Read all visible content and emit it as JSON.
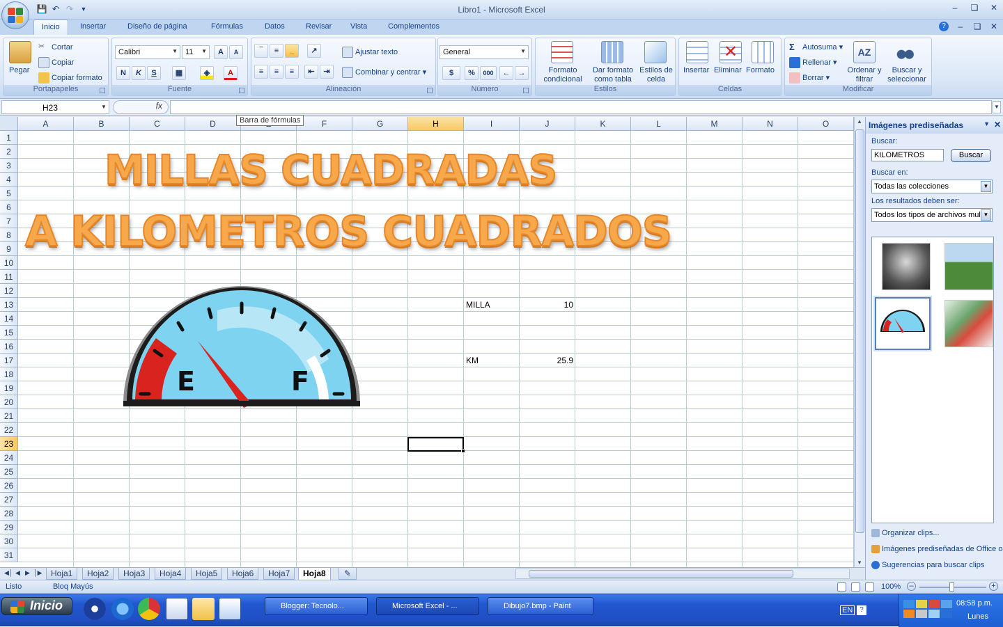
{
  "window": {
    "title": "Libro1 - Microsoft Excel"
  },
  "tabs": [
    "Inicio",
    "Insertar",
    "Diseño de página",
    "Fórmulas",
    "Datos",
    "Revisar",
    "Vista",
    "Complementos"
  ],
  "ribbon": {
    "clipboard": {
      "label": "Portapapeles",
      "paste": "Pegar",
      "cut": "Cortar",
      "copy": "Copiar",
      "format_painter": "Copiar formato"
    },
    "font": {
      "label": "Fuente",
      "font_name": "Calibri",
      "font_size": "11",
      "bold": "N",
      "italic": "K",
      "underline": "S"
    },
    "alignment": {
      "label": "Alineación",
      "wrap": "Ajustar texto",
      "merge": "Combinar y centrar"
    },
    "number": {
      "label": "Número",
      "format": "General",
      "currency": "$",
      "percent": "%",
      "thousands": "000"
    },
    "styles": {
      "label": "Estilos",
      "conditional": "Formato condicional",
      "as_table": "Dar formato como tabla",
      "cell_styles": "Estilos de celda"
    },
    "cells": {
      "label": "Celdas",
      "insert": "Insertar",
      "delete": "Eliminar",
      "format": "Formato"
    },
    "editing": {
      "label": "Modificar",
      "autosum": "Autosuma",
      "fill": "Rellenar",
      "clear": "Borrar",
      "sort": "Ordenar y filtrar",
      "find": "Buscar y seleccionar"
    }
  },
  "formula_bar": {
    "name_box": "H23",
    "fx": "fx",
    "tooltip": "Barra de fórmulas",
    "value": ""
  },
  "sheet": {
    "columns": [
      "A",
      "B",
      "C",
      "D",
      "E",
      "F",
      "G",
      "H",
      "I",
      "J",
      "K",
      "L",
      "M",
      "N",
      "O"
    ],
    "rows": [
      "1",
      "2",
      "3",
      "4",
      "5",
      "6",
      "7",
      "8",
      "9",
      "10",
      "11",
      "12",
      "13",
      "14",
      "15",
      "16",
      "17",
      "18",
      "19",
      "20",
      "21",
      "22",
      "23",
      "24",
      "25",
      "26",
      "27",
      "28",
      "29",
      "30",
      "31"
    ],
    "selected_col": "H",
    "selected_row": "23",
    "wordart_line1": "MILLAS CUADRADAS",
    "wordart_line2": "A KILOMETROS CUADRADOS",
    "cells": {
      "i13": "MILLA",
      "j13": "10",
      "i17": "KM",
      "j17": "25.9"
    },
    "gauge": {
      "empty": "E",
      "full": "F"
    }
  },
  "sheet_tabs": [
    "Hoja1",
    "Hoja2",
    "Hoja3",
    "Hoja4",
    "Hoja5",
    "Hoja6",
    "Hoja7",
    "Hoja8"
  ],
  "active_sheet": "Hoja8",
  "clip_pane": {
    "title": "Imágenes prediseñadas",
    "search_label": "Buscar:",
    "search_value": "KILOMETROS",
    "search_button": "Buscar",
    "search_in_label": "Buscar en:",
    "search_in": "Todas las colecciones",
    "results_label": "Los resultados deben ser:",
    "results_type": "Todos los tipos de archivos mult",
    "link_organize": "Organizar clips...",
    "link_online": "Imágenes prediseñadas de Office o",
    "link_tips": "Sugerencias para buscar clips"
  },
  "status": {
    "ready": "Listo",
    "caps": "Bloq Mayús",
    "zoom": "100%"
  },
  "taskbar": {
    "start": "Inicio",
    "tasks": [
      "Blogger: Tecnolo...",
      "Microsoft Excel - ...",
      "Dibujo7.bmp - Paint"
    ],
    "lang": "EN",
    "time": "08:58 p.m.",
    "day": "Lunes"
  },
  "colors": {
    "accent": "#15428b",
    "wordart": "#f6a84a",
    "gauge_blue": "#7dd3f0",
    "gauge_red": "#d8231e"
  }
}
